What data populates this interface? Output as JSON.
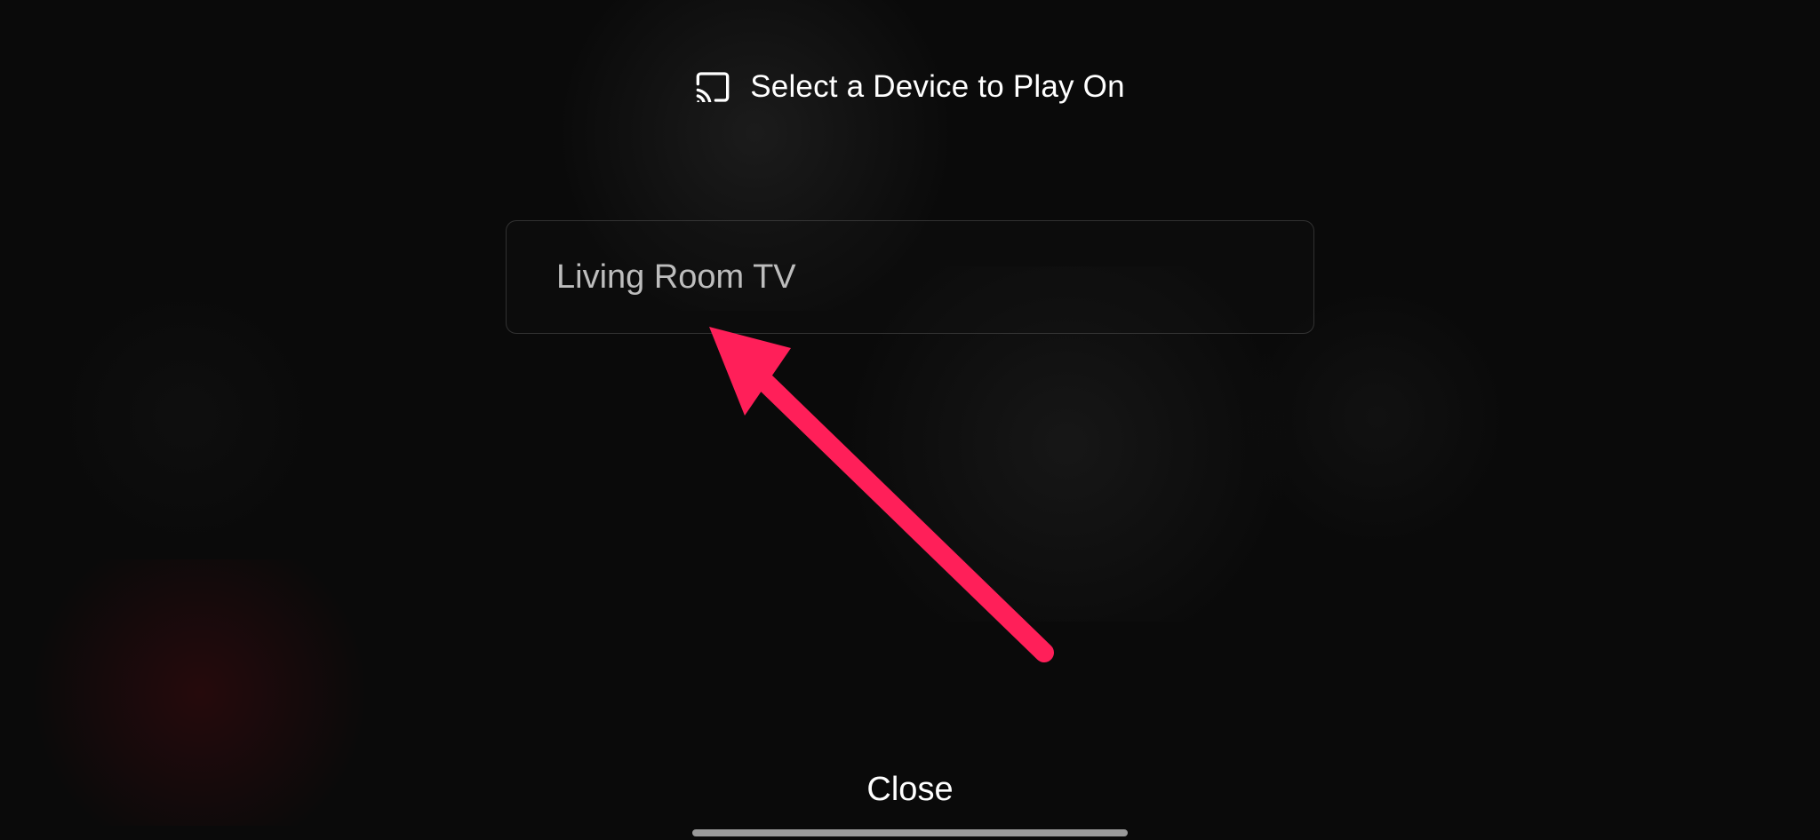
{
  "header": {
    "title": "Select a Device to Play On",
    "icon": "cast-icon"
  },
  "devices": [
    {
      "name": "Living Room TV"
    }
  ],
  "footer": {
    "close_label": "Close"
  },
  "annotation": {
    "type": "arrow",
    "color": "#ff1f59"
  }
}
